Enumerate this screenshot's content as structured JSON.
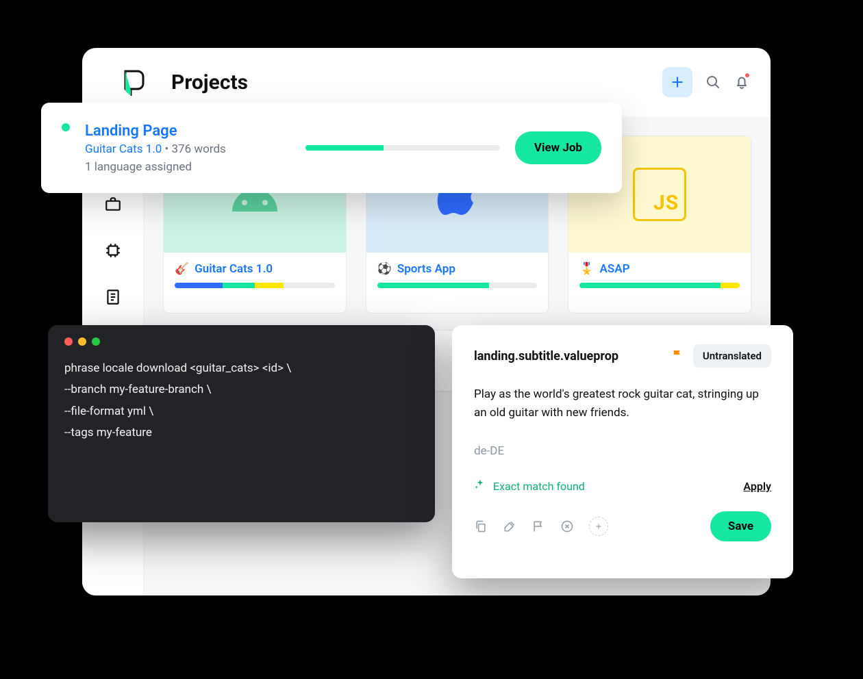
{
  "header": {
    "title": "Projects"
  },
  "projects": [
    {
      "emoji": "🎸",
      "name": "Guitar Cats 1.0",
      "segments": [
        {
          "color": "blue",
          "pct": 30
        },
        {
          "color": "teal",
          "pct": 20
        },
        {
          "color": "yellow",
          "pct": 18
        }
      ]
    },
    {
      "emoji": "⚽",
      "name": "Sports App",
      "segments": [
        {
          "color": "teal",
          "pct": 70
        }
      ]
    },
    {
      "emoji": "🎖️",
      "name": "ASAP",
      "segments": [
        {
          "color": "teal",
          "pct": 88
        },
        {
          "color": "yellow",
          "pct": 12
        }
      ]
    }
  ],
  "job": {
    "title": "Landing Page",
    "project": "Guitar Cats 1.0",
    "words": "376 words",
    "languages": "1 language assigned",
    "progress_pct": 40,
    "button": "View Job"
  },
  "terminal": {
    "lines": [
      "phrase locale download <guitar_cats> <id> \\",
      "--branch my-feature-branch \\",
      "--file-format yml \\",
      "--tags my-feature"
    ]
  },
  "editor": {
    "key": "landing.subtitle.valueprop",
    "status": "Untranslated",
    "source": "Play as the world's greatest rock guitar cat, stringing up an old guitar with new friends.",
    "locale": "de-DE",
    "match_text": "Exact match found",
    "apply": "Apply",
    "save": "Save"
  }
}
